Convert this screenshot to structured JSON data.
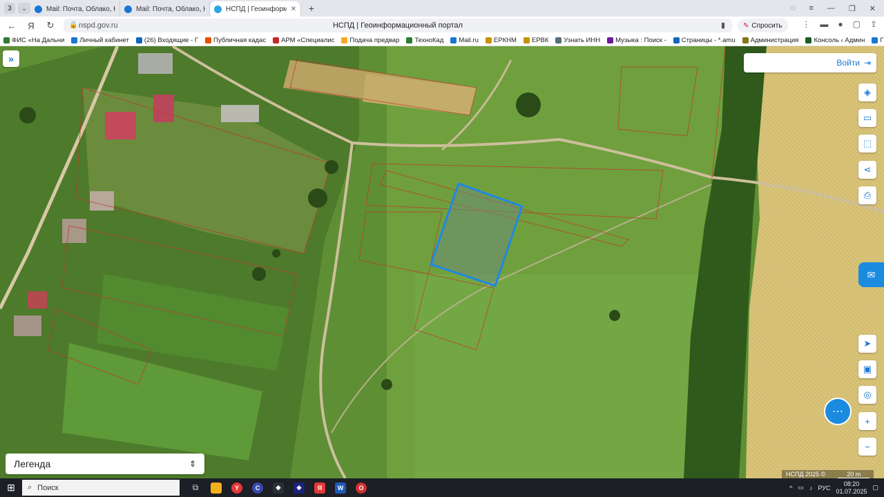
{
  "browser": {
    "tab_count": "3",
    "tabs": [
      {
        "title": "Mail: Почта, Облако, Кале"
      },
      {
        "title": "Mail: Почта, Облако, Кале"
      },
      {
        "title": "НСПД | Геоинформаци"
      }
    ],
    "url": "nspd.gov.ru",
    "page_title": "НСПД | Геоинформационный портал",
    "ask_label": "Спросить"
  },
  "bookmarks": [
    {
      "label": "ФИС «На Дальни",
      "color": "#2e7d32"
    },
    {
      "label": "Личный кабинет",
      "color": "#1976d2"
    },
    {
      "label": "(26) Входящие - Г",
      "color": "#1565c0"
    },
    {
      "label": "Публичная кадас",
      "color": "#e65100"
    },
    {
      "label": "АРМ «Специалис",
      "color": "#c62828"
    },
    {
      "label": "Подача предвар",
      "color": "#f9a825"
    },
    {
      "label": "ТехноКад",
      "color": "#2e7d32"
    },
    {
      "label": "Mail.ru",
      "color": "#1976d2"
    },
    {
      "label": "ЕРКНМ",
      "color": "#c79100"
    },
    {
      "label": "ЕРВК",
      "color": "#c79100"
    },
    {
      "label": "Узнать ИНН",
      "color": "#546e7a"
    },
    {
      "label": "Музыка : Поиск -",
      "color": "#6a1b9a"
    },
    {
      "label": "Страницы - *.amu",
      "color": "#1565c0"
    },
    {
      "label": "Администрация",
      "color": "#827717"
    },
    {
      "label": "Консоль ‹ Админ",
      "color": "#1b5e20"
    },
    {
      "label": "ГИС",
      "color": "#1976d2"
    }
  ],
  "map": {
    "login_label": "Войти",
    "legend_label": "Легенда",
    "copyright": "НСПД 2025 ©",
    "scale_label": "20 m",
    "selection_color": "#1e88e5",
    "parcel_color": "#c0392b"
  },
  "taskbar": {
    "search_placeholder": "Поиск",
    "lang": "РУС",
    "time": "08:20",
    "date": "01.07.2025"
  }
}
